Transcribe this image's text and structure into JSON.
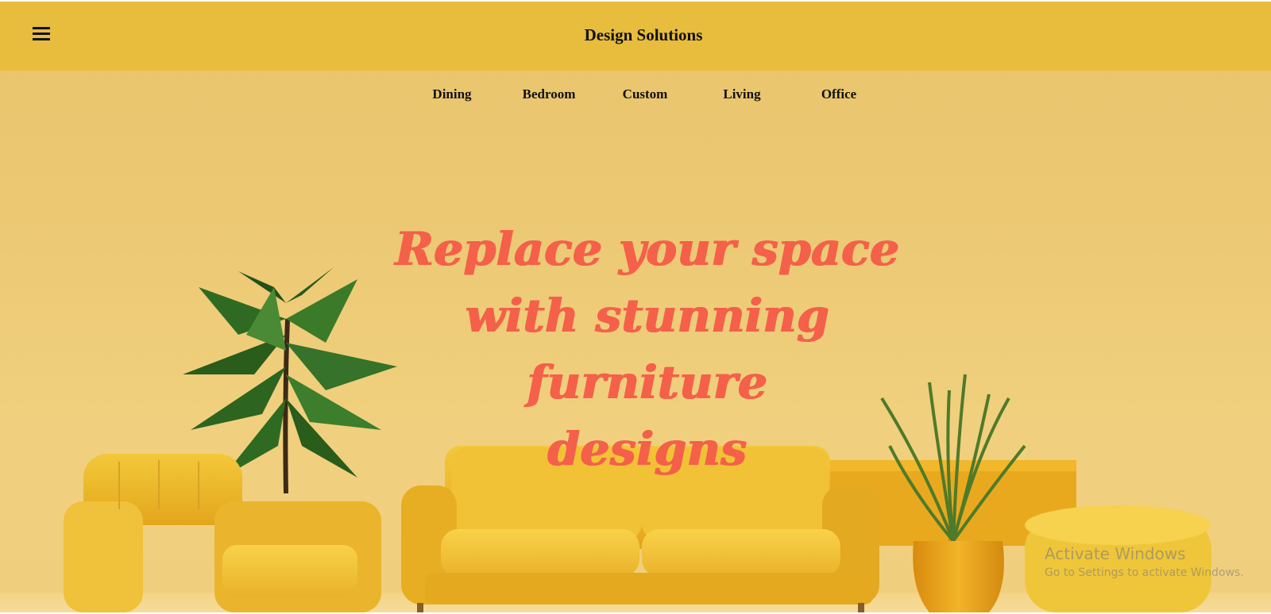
{
  "header": {
    "brand": "Design Solutions",
    "menu_icon": "hamburger-menu-icon",
    "color": "#e8bc3c"
  },
  "categories": [
    {
      "label": "Dining"
    },
    {
      "label": "Bedroom"
    },
    {
      "label": "Custom"
    },
    {
      "label": "Living"
    },
    {
      "label": "Office"
    }
  ],
  "hero": {
    "line1": "Replace your space",
    "line2": "with stunning furniture",
    "line3": "designs",
    "color": "#f4604a"
  },
  "watermark": {
    "title": "Activate Windows",
    "subtitle": "Go to Settings to activate Windows."
  }
}
